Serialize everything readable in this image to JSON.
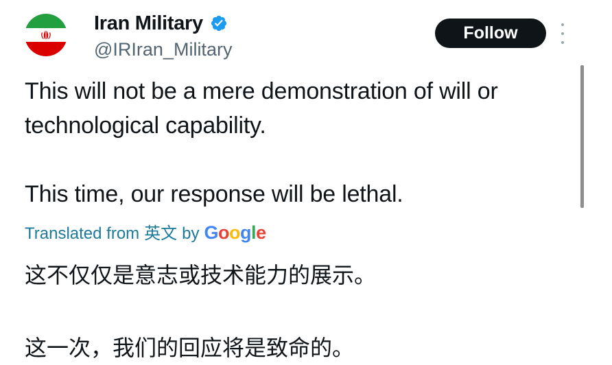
{
  "tweet": {
    "display_name": "Iran Military",
    "handle": "@IRIran_Military",
    "follow_label": "Follow",
    "verified": true,
    "paragraphs": [
      "This will not be a mere demonstration of will or technological capability.",
      "This time, our response will be lethal."
    ],
    "translation": {
      "prefix": "Translated from",
      "language": "英文",
      "by": "by",
      "provider": "Google"
    },
    "translated_paragraphs": [
      "这不仅仅是意志或技术能力的展示。",
      "这一次，我们的回应将是致命的。"
    ]
  },
  "colors": {
    "follow_bg": "#0f1419",
    "verified_blue": "#1d9bf0",
    "handle_gray": "#536471",
    "translation_link": "#1d7a9b",
    "flag_green": "#239f40",
    "flag_red": "#da0000"
  },
  "icons": {
    "avatar": "iran-flag-avatar",
    "verified": "verified-badge-icon",
    "more": "more-options-icon"
  }
}
